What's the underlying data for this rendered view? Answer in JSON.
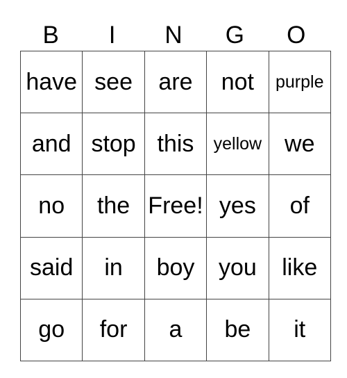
{
  "header": [
    "B",
    "I",
    "N",
    "G",
    "O"
  ],
  "rows": [
    [
      "have",
      "see",
      "are",
      "not",
      "purple"
    ],
    [
      "and",
      "stop",
      "this",
      "yellow",
      "we"
    ],
    [
      "no",
      "the",
      "Free!",
      "yes",
      "of"
    ],
    [
      "said",
      "in",
      "boy",
      "you",
      "like"
    ],
    [
      "go",
      "for",
      "a",
      "be",
      "it"
    ]
  ],
  "colors": {
    "text": "#000000",
    "border": "#444444",
    "background": "#ffffff"
  }
}
